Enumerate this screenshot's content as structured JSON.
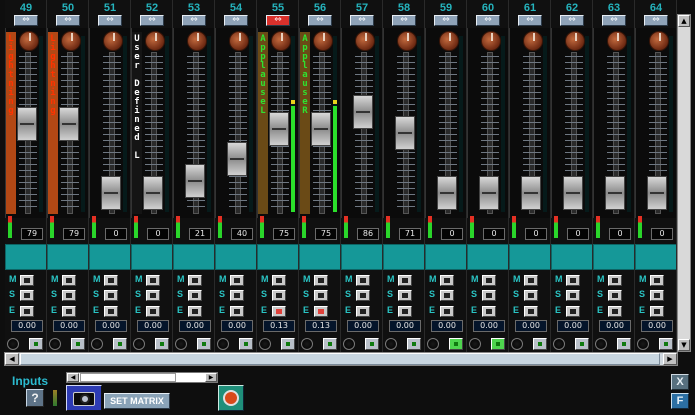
{
  "theme": {
    "channel_number_color": "#25b3bd",
    "teal_panel": "#159898",
    "link_active": "#d9312c",
    "meter_green": "#2be02b"
  },
  "button_letters": {
    "mute": "M",
    "solo": "S",
    "effect": "E"
  },
  "link_glyph": "⇔",
  "channels": [
    {
      "number": "49",
      "label": "Lightning",
      "label_style": "orange",
      "volume": "79",
      "pan": "0.00",
      "link_active": false,
      "fader_level": 0.58,
      "meter_level": 0.0,
      "effect_active": false,
      "input_active": false
    },
    {
      "number": "50",
      "label": "Lightning",
      "label_style": "orange",
      "volume": "79",
      "pan": "0.00",
      "link_active": false,
      "fader_level": 0.58,
      "meter_level": 0.0,
      "effect_active": false,
      "input_active": false
    },
    {
      "number": "51",
      "label": "",
      "label_style": "none",
      "volume": "0",
      "pan": "0.00",
      "link_active": false,
      "fader_level": 0.12,
      "meter_level": 0.0,
      "effect_active": false,
      "input_active": false
    },
    {
      "number": "52",
      "label": "User Defined L",
      "label_style": "white",
      "volume": "0",
      "pan": "0.00",
      "link_active": false,
      "fader_level": 0.12,
      "meter_level": 0.0,
      "effect_active": false,
      "input_active": false
    },
    {
      "number": "53",
      "label": "",
      "label_style": "none",
      "volume": "21",
      "pan": "0.00",
      "link_active": false,
      "fader_level": 0.2,
      "meter_level": 0.0,
      "effect_active": false,
      "input_active": false
    },
    {
      "number": "54",
      "label": "",
      "label_style": "none",
      "volume": "40",
      "pan": "0.00",
      "link_active": false,
      "fader_level": 0.35,
      "meter_level": 0.0,
      "effect_active": false,
      "input_active": false
    },
    {
      "number": "55",
      "label": "ApplauseL",
      "label_style": "olive",
      "volume": "75",
      "pan": "0.13",
      "link_active": true,
      "fader_level": 0.55,
      "meter_level": 0.6,
      "effect_active": true,
      "input_active": false
    },
    {
      "number": "56",
      "label": "ApplauseR",
      "label_style": "olive",
      "volume": "75",
      "pan": "0.13",
      "link_active": false,
      "fader_level": 0.55,
      "meter_level": 0.6,
      "effect_active": true,
      "input_active": false
    },
    {
      "number": "57",
      "label": "",
      "label_style": "none",
      "volume": "86",
      "pan": "0.00",
      "link_active": false,
      "fader_level": 0.66,
      "meter_level": 0.0,
      "effect_active": false,
      "input_active": false
    },
    {
      "number": "58",
      "label": "",
      "label_style": "none",
      "volume": "71",
      "pan": "0.00",
      "link_active": false,
      "fader_level": 0.52,
      "meter_level": 0.0,
      "effect_active": false,
      "input_active": false
    },
    {
      "number": "59",
      "label": "",
      "label_style": "none",
      "volume": "0",
      "pan": "0.00",
      "link_active": false,
      "fader_level": 0.12,
      "meter_level": 0.0,
      "effect_active": false,
      "input_active": true
    },
    {
      "number": "60",
      "label": "",
      "label_style": "none",
      "volume": "0",
      "pan": "0.00",
      "link_active": false,
      "fader_level": 0.12,
      "meter_level": 0.0,
      "effect_active": false,
      "input_active": true
    },
    {
      "number": "61",
      "label": "",
      "label_style": "none",
      "volume": "0",
      "pan": "0.00",
      "link_active": false,
      "fader_level": 0.12,
      "meter_level": 0.0,
      "effect_active": false,
      "input_active": false
    },
    {
      "number": "62",
      "label": "",
      "label_style": "none",
      "volume": "0",
      "pan": "0.00",
      "link_active": false,
      "fader_level": 0.12,
      "meter_level": 0.0,
      "effect_active": false,
      "input_active": false
    },
    {
      "number": "63",
      "label": "",
      "label_style": "none",
      "volume": "0",
      "pan": "0.00",
      "link_active": false,
      "fader_level": 0.12,
      "meter_level": 0.0,
      "effect_active": false,
      "input_active": false
    },
    {
      "number": "64",
      "label": "",
      "label_style": "none",
      "volume": "0",
      "pan": "0.00",
      "link_active": false,
      "fader_level": 0.12,
      "meter_level": 0.0,
      "effect_active": false,
      "input_active": false
    }
  ],
  "bottom": {
    "section_title": "Inputs",
    "help_label": "?",
    "set_matrix_label": "SET MATRIX",
    "close_label": "X",
    "f_label": "F"
  },
  "scrollbar": {
    "up": "▲",
    "down": "▼",
    "left": "◀",
    "right": "▶"
  }
}
